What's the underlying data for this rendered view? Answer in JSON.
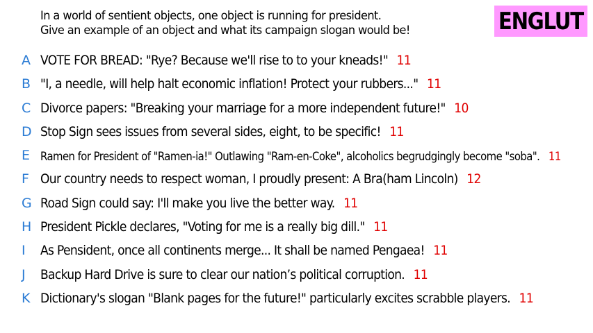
{
  "prompt": {
    "line1": "In a world of sentient objects, one object is running for president.",
    "line2": "Give an example of an object and what its campaign slogan would be!"
  },
  "logo": {
    "text": "ENGLUT",
    "background": "#ff99ff"
  },
  "colors": {
    "letter": "#2a7bd4",
    "score": "#e00000",
    "text": "#000000"
  },
  "answers": [
    {
      "letter": "A",
      "text": "VOTE FOR BREAD: \"Rye? Because we'll rise to to your kneads!\"",
      "score": "11"
    },
    {
      "letter": "B",
      "text": "\"I, a needle, will help halt economic inflation! Protect your rubbers...\"",
      "score": "11"
    },
    {
      "letter": "C",
      "text": "Divorce papers: \"Breaking your marriage for a more independent future!\"",
      "score": "10"
    },
    {
      "letter": "D",
      "text": "Stop Sign sees issues from several sides, eight, to be specific!",
      "score": "11"
    },
    {
      "letter": "E",
      "text": "Ramen for President of \"Ramen-ia!\" Outlawing \"Ram-en-Coke\", alcoholics begrudgingly become \"soba\".",
      "score": "11"
    },
    {
      "letter": "F",
      "text": "Our country needs to respect woman, I proudly present: A Bra(ham Lincoln)",
      "score": "12"
    },
    {
      "letter": "G",
      "text": "Road Sign could say: I'll make you live the better way.",
      "score": "11"
    },
    {
      "letter": "H",
      "text": "President Pickle declares, \"Voting for me is a really big dill.\"",
      "score": "11"
    },
    {
      "letter": "I",
      "text": "As Pensident, once all continents merge... It shall be named Pengaea!",
      "score": "11"
    },
    {
      "letter": "J",
      "text": "Backup Hard Drive is sure to clear our nation’s political corruption.",
      "score": "11"
    },
    {
      "letter": "K",
      "text": "Dictionary's slogan \"Blank pages for the future!\" particularly excites scrabble players.",
      "score": "11"
    }
  ]
}
